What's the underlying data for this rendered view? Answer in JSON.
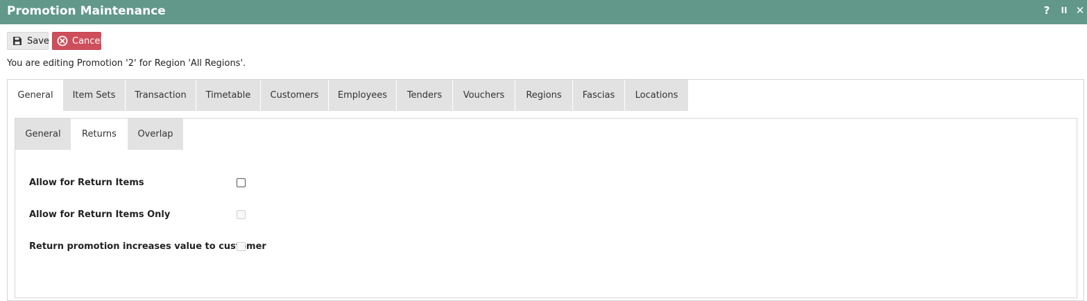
{
  "window": {
    "title": "Promotion Maintenance",
    "controls": {
      "help": "?",
      "pause": "II",
      "close": "✕"
    }
  },
  "toolbar": {
    "save_label": "Save",
    "cancel_label": "Cancel"
  },
  "message": "You are editing Promotion '2' for Region 'All Regions'.",
  "main_tabs": [
    {
      "label": "General",
      "active": true
    },
    {
      "label": "Item Sets",
      "active": false
    },
    {
      "label": "Transaction",
      "active": false
    },
    {
      "label": "Timetable",
      "active": false
    },
    {
      "label": "Customers",
      "active": false
    },
    {
      "label": "Employees",
      "active": false
    },
    {
      "label": "Tenders",
      "active": false
    },
    {
      "label": "Vouchers",
      "active": false
    },
    {
      "label": "Regions",
      "active": false
    },
    {
      "label": "Fascias",
      "active": false
    },
    {
      "label": "Locations",
      "active": false
    }
  ],
  "sub_tabs": [
    {
      "label": "General",
      "active": false
    },
    {
      "label": "Returns",
      "active": true
    },
    {
      "label": "Overlap",
      "active": false
    }
  ],
  "returns_fields": [
    {
      "label": "Allow for Return Items",
      "checked": false,
      "enabled": true
    },
    {
      "label": "Allow for Return Items Only",
      "checked": false,
      "enabled": false
    },
    {
      "label": "Return promotion increases value to customer",
      "checked": false,
      "enabled": false
    }
  ],
  "colors": {
    "titlebar": "#61988a",
    "cancel": "#cf4e5c",
    "tab_inactive": "#e2e2e2"
  }
}
